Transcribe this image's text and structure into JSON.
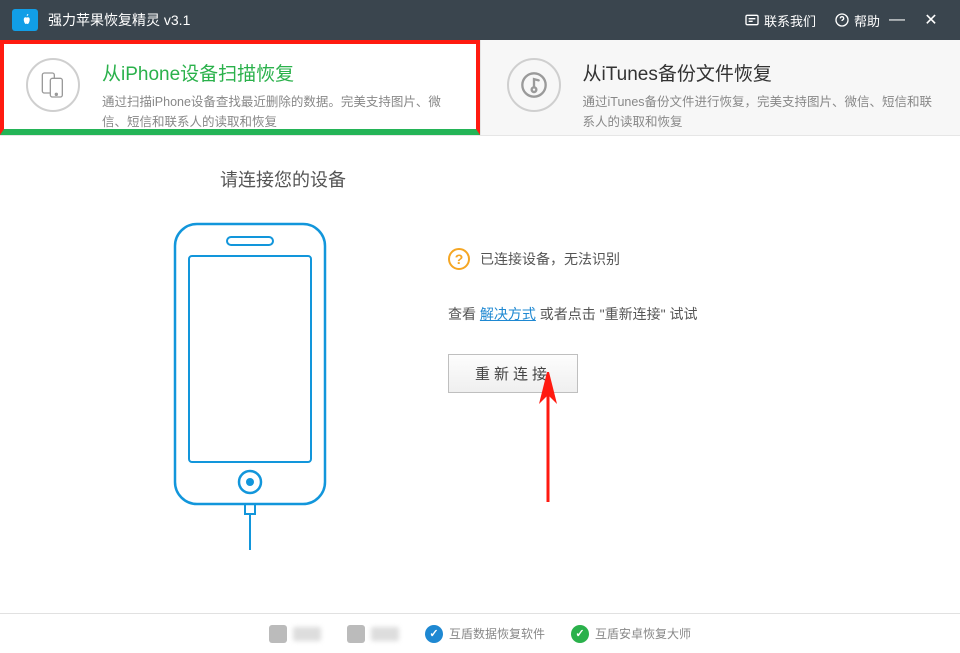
{
  "titlebar": {
    "app_title": "强力苹果恢复精灵 v3.1",
    "contact": "联系我们",
    "help": "帮助"
  },
  "tabs": {
    "iphone": {
      "title": "从iPhone设备扫描恢复",
      "desc": "通过扫描iPhone设备查找最近删除的数据。完美支持图片、微信、短信和联系人的读取和恢复"
    },
    "itunes": {
      "title": "从iTunes备份文件恢复",
      "desc": "通过iTunes备份文件进行恢复，完美支持图片、微信、短信和联系人的读取和恢复"
    }
  },
  "main": {
    "heading": "请连接您的设备",
    "status": "已连接设备，无法识别",
    "hint_prefix": "查看 ",
    "hint_link": "解决方式",
    "hint_mid": " 或者点击 \"重新连接\" 试试",
    "reconnect": "重新连接"
  },
  "footer": {
    "item1": " ",
    "item2": " ",
    "item3": "互盾数据恢复软件",
    "item4": "互盾安卓恢复大师"
  },
  "colors": {
    "accent_green": "#2ab14b",
    "highlight_red": "#ff1a10",
    "link_blue": "#1e88d2",
    "warn_orange": "#f5a623",
    "phone_blue": "#1296db"
  }
}
